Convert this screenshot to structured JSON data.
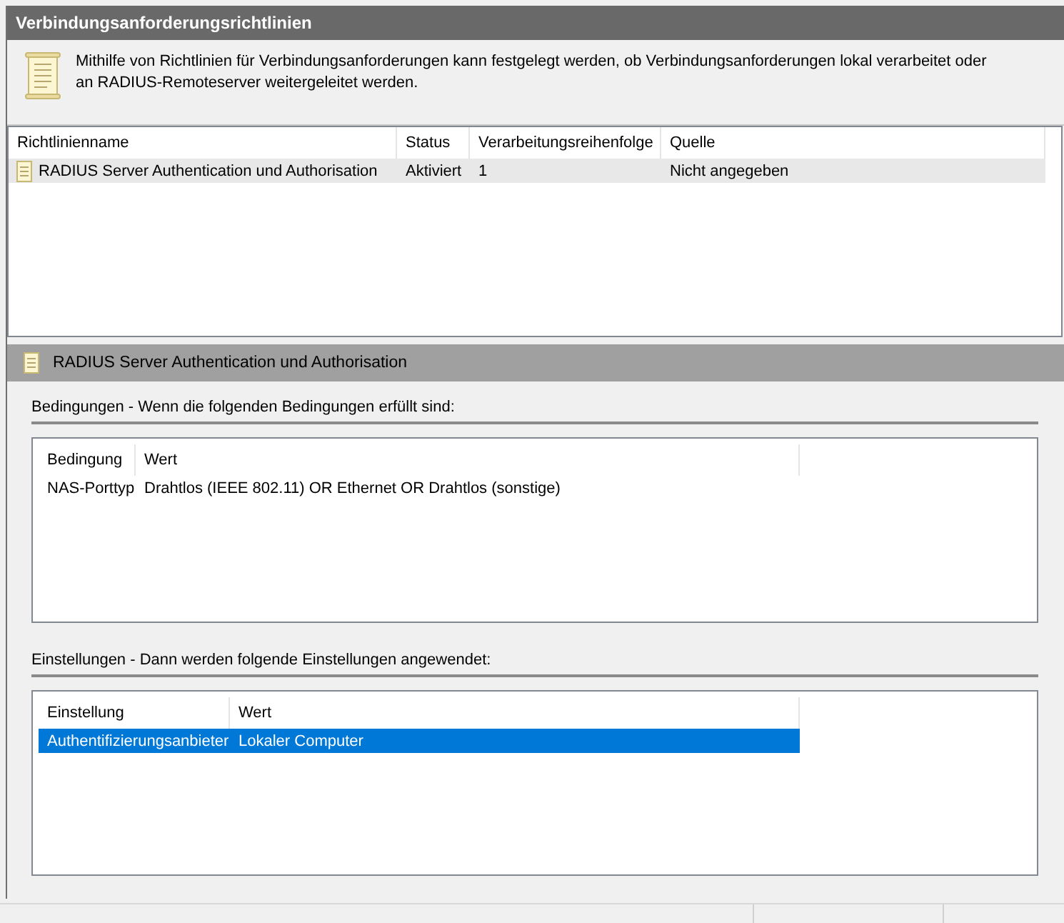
{
  "window": {
    "title": "Verbindungsanforderungsrichtlinien"
  },
  "description": "Mithilfe von Richtlinien für Verbindungsanforderungen kann festgelegt werden, ob Verbindungsanforderungen lokal verarbeitet oder an RADIUS-Remoteserver weitergeleitet werden.",
  "policies": {
    "columns": [
      "Richtlinienname",
      "Status",
      "Verarbeitungsreihenfolge",
      "Quelle"
    ],
    "rows": [
      {
        "cells": [
          "RADIUS Server Authentication und Authorisation",
          "Aktiviert",
          "1",
          "Nicht angegeben"
        ],
        "selected": true
      }
    ]
  },
  "detail": {
    "title": "RADIUS Server Authentication und Authorisation",
    "sections": [
      {
        "heading": "Bedingungen - Wenn die folgenden Bedingungen erfüllt sind:",
        "columns": [
          "Bedingung",
          "Wert"
        ],
        "rows": [
          {
            "cells": [
              "NAS-Porttyp",
              "Drahtlos (IEEE 802.11) OR Ethernet OR Drahtlos (sonstige)"
            ],
            "selected": false
          }
        ]
      },
      {
        "heading": "Einstellungen - Dann werden folgende Einstellungen angewendet:",
        "columns": [
          "Einstellung",
          "Wert"
        ],
        "rows": [
          {
            "cells": [
              "Authentifizierungsanbieter",
              "Lokaler Computer"
            ],
            "selected": true
          }
        ]
      }
    ]
  }
}
